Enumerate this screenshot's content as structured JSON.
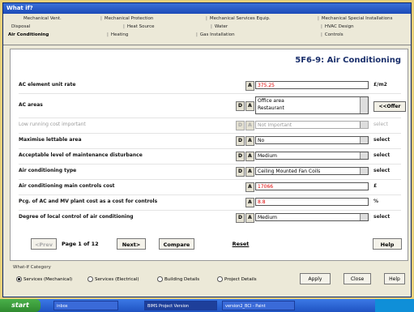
{
  "window": {
    "title": "What if?"
  },
  "tabs": {
    "row1": [
      "Mechanical Vent.",
      "Mechanical Protection",
      "Mechanical Services Equip.",
      "Mechanical Special Installations"
    ],
    "row2": [
      "Disposal",
      "Heat Source",
      "Water",
      "HVAC Design"
    ],
    "row3": [
      "Air Conditioning",
      "Heating",
      "Gas Installation",
      "Controls"
    ]
  },
  "panel": {
    "title": "5F6-9: Air Conditioning",
    "rows": [
      {
        "label": "AC element unit rate",
        "value": "375.25",
        "unit": "£/m2"
      },
      {
        "label": "AC areas",
        "values": [
          "Office area",
          "Restaurant"
        ],
        "button": "<<Offer"
      },
      {
        "label": "Low running cost important",
        "value": "Not Important",
        "unit": "select"
      },
      {
        "label": "Maximise lettable area",
        "value": "No",
        "unit": "select"
      },
      {
        "label": "Acceptable level of maintenance disturbance",
        "value": "Medium",
        "unit": "select"
      },
      {
        "label": "Air conditioning type",
        "value": "Ceiling Mounted Fan Coils",
        "unit": "select"
      },
      {
        "label": "Air conditioning main controls cost",
        "value": "17066",
        "unit": "£"
      },
      {
        "label": "Pcg. of AC and MV plant cost as a cost for controls",
        "value": "8.8",
        "unit": "%"
      },
      {
        "label": "Degree of local control of air conditioning",
        "value": "Medium",
        "unit": "select"
      }
    ],
    "btn_d": "D",
    "btn_a": "A"
  },
  "pager": {
    "prev": "<Prev",
    "page_label": "Page 1 of 12",
    "next": "Next>",
    "compare": "Compare",
    "reset": "Reset",
    "help": "Help"
  },
  "category": {
    "title": "What-If Category",
    "options": [
      "Services (Mechanical)",
      "Services (Electrical)",
      "Building Details",
      "Project Details"
    ],
    "selected": 0,
    "apply": "Apply",
    "close": "Close",
    "help": "Help"
  },
  "taskbar": {
    "start": "start",
    "items": [
      "inbox",
      "BIMS Project Version",
      "version2_BCI - Paint"
    ]
  }
}
